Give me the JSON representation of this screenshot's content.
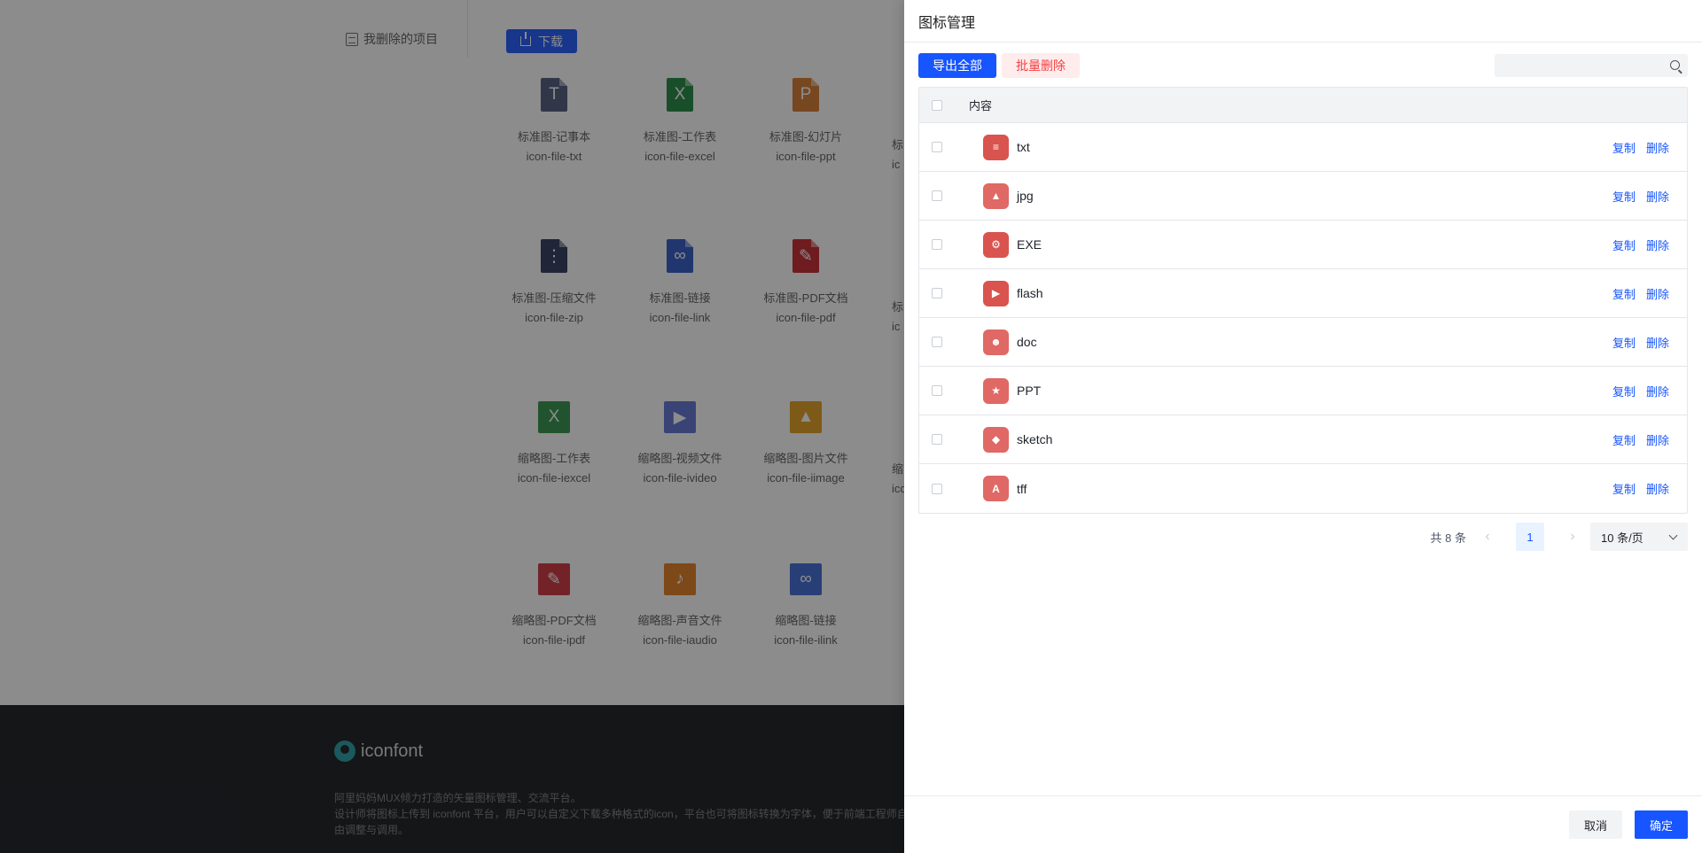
{
  "background": {
    "sidebar_link": "我删除的项目",
    "download_label": "下载",
    "icons": [
      {
        "name": "标准图-记事本",
        "code": "icon-file-txt",
        "color": "#5b6386",
        "glyph": "T",
        "shape": "file"
      },
      {
        "name": "标准图-工作表",
        "code": "icon-file-excel",
        "color": "#2f8f4e",
        "glyph": "X",
        "shape": "file"
      },
      {
        "name": "标准图-幻灯片",
        "code": "icon-file-ppt",
        "color": "#d9823b",
        "glyph": "P",
        "shape": "file"
      },
      {
        "name": "标准图-压缩文件",
        "code": "icon-file-zip",
        "color": "#3b4465",
        "glyph": "⋮",
        "shape": "file"
      },
      {
        "name": "标准图-链接",
        "code": "icon-file-link",
        "color": "#3d63c9",
        "glyph": "∞",
        "shape": "file"
      },
      {
        "name": "标准图-PDF文档",
        "code": "icon-file-pdf",
        "color": "#c8343a",
        "glyph": "✎",
        "shape": "file"
      },
      {
        "name": "缩略图-工作表",
        "code": "icon-file-iexcel",
        "color": "#3d9a55",
        "glyph": "X",
        "shape": "square"
      },
      {
        "name": "缩略图-视频文件",
        "code": "icon-file-ivideo",
        "color": "#6a7bd6",
        "glyph": "▶",
        "shape": "square"
      },
      {
        "name": "缩略图-图片文件",
        "code": "icon-file-iimage",
        "color": "#e3a52b",
        "glyph": "▲",
        "shape": "square"
      },
      {
        "name": "缩略图-PDF文档",
        "code": "icon-file-ipdf",
        "color": "#d1414a",
        "glyph": "✎",
        "shape": "square"
      },
      {
        "name": "缩略图-声音文件",
        "code": "icon-file-iaudio",
        "color": "#e3862f",
        "glyph": "♪",
        "shape": "square"
      },
      {
        "name": "缩略图-链接",
        "code": "icon-file-ilink",
        "color": "#4a72d8",
        "glyph": "∞",
        "shape": "square"
      }
    ],
    "partial_labels": [
      "标",
      "ic",
      "标",
      "ic",
      "缩",
      "icc"
    ],
    "footer": {
      "logo_text": "iconfont",
      "line1": "阿里妈妈MUX倾力打造的矢量图标管理、交流平台。",
      "line2": "设计师将图标上传到 iconfont 平台，用户可以自定义下载多种格式的icon，平台也可将图标转换为字体，便于前端工程师自",
      "line3": "由调整与调用。"
    }
  },
  "drawer": {
    "title": "图标管理",
    "export_all_label": "导出全部",
    "batch_delete_label": "批量删除",
    "search_placeholder": "",
    "table_header": "内容",
    "rows": [
      {
        "name": "txt",
        "glyph": "≡",
        "tone": "dark"
      },
      {
        "name": "jpg",
        "glyph": "▲",
        "tone": "light"
      },
      {
        "name": "EXE",
        "glyph": "⚙",
        "tone": "dark"
      },
      {
        "name": "flash",
        "glyph": "▶",
        "tone": "dark"
      },
      {
        "name": "doc",
        "glyph": "☻",
        "tone": "light"
      },
      {
        "name": "PPT",
        "glyph": "★",
        "tone": "light"
      },
      {
        "name": "sketch",
        "glyph": "◆",
        "tone": "light"
      },
      {
        "name": "tff",
        "glyph": "A",
        "tone": "light"
      }
    ],
    "copy_label": "复制",
    "delete_label": "删除",
    "pagination": {
      "total_text": "共 8 条",
      "current_page": "1",
      "page_size_text": "10 条/页"
    },
    "cancel_label": "取消",
    "confirm_label": "确定"
  },
  "colors": {
    "primary": "#1655ff",
    "danger": "#f53f3f",
    "row_icon": "#d9534f"
  }
}
